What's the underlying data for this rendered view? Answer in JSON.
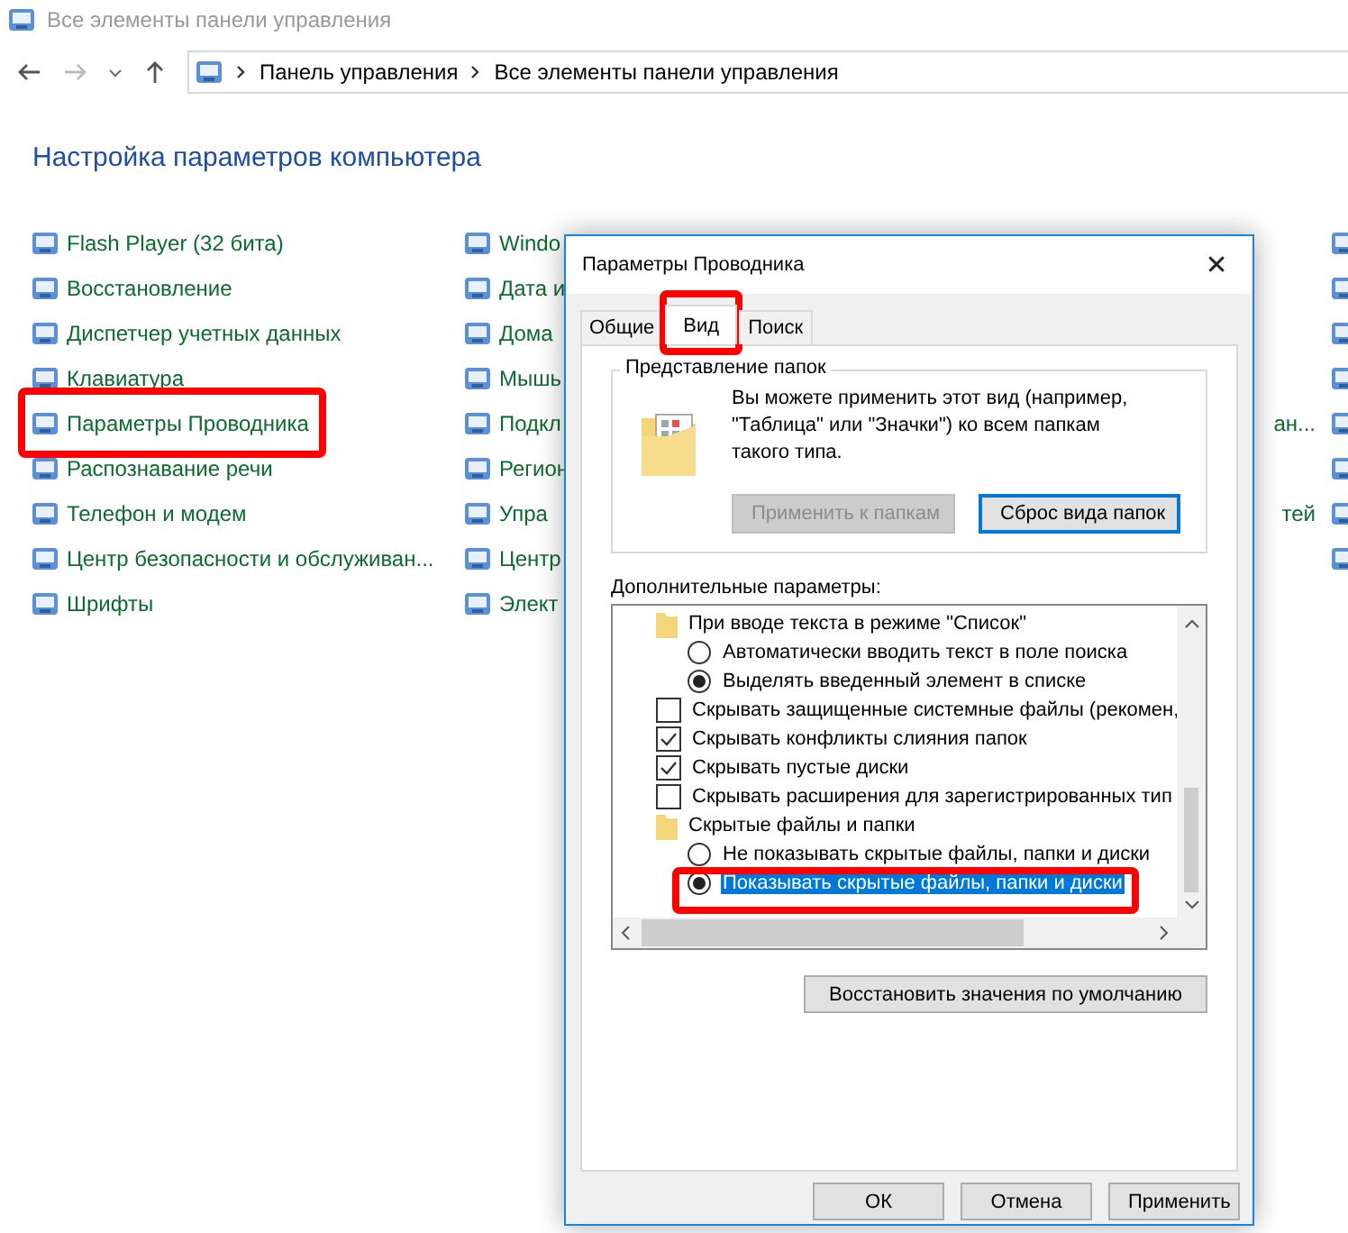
{
  "window": {
    "title": "Все элементы панели управления"
  },
  "address_bar": {
    "crumbs": [
      "Панель управления",
      "Все элементы панели управления"
    ]
  },
  "heading": "Настройка параметров компьютера",
  "columns": [
    {
      "items": [
        {
          "label": "Flash Player (32 бита)",
          "highlighted": false
        },
        {
          "label": "Восстановление",
          "highlighted": false
        },
        {
          "label": "Диспетчер учетных данных",
          "highlighted": false
        },
        {
          "label": "Клавиатура",
          "highlighted": false
        },
        {
          "label": "Параметры Проводника",
          "highlighted": true
        },
        {
          "label": "Распознавание речи",
          "highlighted": false
        },
        {
          "label": "Телефон и модем",
          "highlighted": false
        },
        {
          "label": "Центр безопасности и обслуживан...",
          "highlighted": false
        },
        {
          "label": "Шрифты",
          "highlighted": false
        }
      ]
    },
    {
      "items": [
        {
          "label": "Windo",
          "highlighted": false
        },
        {
          "label": "Дата и",
          "highlighted": false
        },
        {
          "label": "Дома",
          "highlighted": false
        },
        {
          "label": "Мышь",
          "highlighted": false
        },
        {
          "label": "Подкл",
          "highlighted": false
        },
        {
          "label": "Регион",
          "highlighted": false
        },
        {
          "label": "Упра",
          "highlighted": false
        },
        {
          "label": "Центр",
          "highlighted": false
        },
        {
          "label": "Элект",
          "highlighted": false
        }
      ]
    }
  ],
  "column_3_fragments": [
    {
      "kind": "icon"
    },
    {
      "kind": "icon"
    },
    {
      "kind": "icon"
    },
    {
      "kind": "icon"
    },
    {
      "kind": "link",
      "label": "ан..."
    },
    {
      "kind": "icon"
    },
    {
      "kind": "link",
      "label": "тей"
    },
    {
      "kind": "icon"
    }
  ],
  "dialog": {
    "title": "Параметры Проводника",
    "close": "✕",
    "tabs": [
      {
        "label": "Общие",
        "selected": false,
        "highlighted": false
      },
      {
        "label": "Вид",
        "selected": true,
        "highlighted": true
      },
      {
        "label": "Поиск",
        "selected": false,
        "highlighted": false
      }
    ],
    "folder_views": {
      "legend": "Представление папок",
      "text": "Вы можете применить этот вид (например, \"Таблица\" или \"Значки\") ко всем папкам такого типа.",
      "buttons": [
        {
          "label": "Применить к папкам",
          "disabled": true,
          "focused": false
        },
        {
          "label": "Сброс вида папок",
          "disabled": false,
          "focused": true
        }
      ]
    },
    "advanced_label": "Дополнительные параметры:",
    "advanced": [
      {
        "kind": "group",
        "label": "При вводе текста в режиме \"Список\"",
        "children": [
          {
            "kind": "radio",
            "label": "Автоматически вводить текст в поле поиска",
            "checked": false,
            "selected": false,
            "highlighted": false
          },
          {
            "kind": "radio",
            "label": "Выделять введенный элемент в списке",
            "checked": true,
            "selected": false,
            "highlighted": false
          }
        ]
      },
      {
        "kind": "checkbox",
        "label": "Скрывать защищенные системные файлы (рекомен,",
        "checked": false
      },
      {
        "kind": "checkbox",
        "label": "Скрывать конфликты слияния папок",
        "checked": true
      },
      {
        "kind": "checkbox",
        "label": "Скрывать пустые диски",
        "checked": true
      },
      {
        "kind": "checkbox",
        "label": "Скрывать расширения для зарегистрированных тип",
        "checked": false
      },
      {
        "kind": "group",
        "label": "Скрытые файлы и папки",
        "children": [
          {
            "kind": "radio",
            "label": "Не показывать скрытые файлы, папки и диски",
            "checked": false,
            "selected": false,
            "highlighted": false
          },
          {
            "kind": "radio",
            "label": "Показывать скрытые файлы, папки и диски",
            "checked": true,
            "selected": true,
            "highlighted": true
          }
        ]
      }
    ],
    "restore_button": "Восстановить значения по умолчанию",
    "footer_buttons": [
      "ОК",
      "Отмена",
      "Применить"
    ]
  }
}
